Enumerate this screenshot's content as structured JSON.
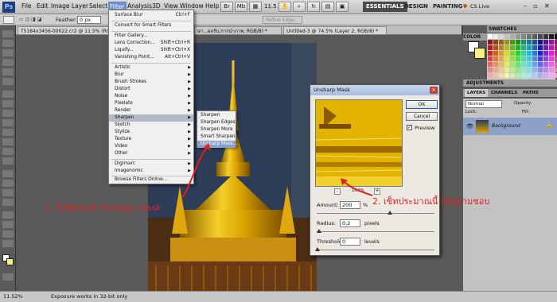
{
  "menubar": {
    "logo": "Ps",
    "items": [
      "File",
      "Edit",
      "Image",
      "Layer",
      "Select",
      "Filter",
      "Analysis",
      "3D",
      "View",
      "Window",
      "Help"
    ],
    "zoom": "11.5",
    "workspaces": [
      "ESSENTIALS",
      "DESIGN",
      "PAINTING"
    ],
    "cs_live": "CS Live"
  },
  "optionsbar": {
    "feather_label": "Feather:",
    "feather_value": "0 px",
    "refine_edge": "Refine Edge..."
  },
  "tabs": [
    "T5184x3456-00022.cr2 @ 11.5% (RGB/8",
    "ษา...ผลรับ,การนำภาพ, RGB/8) *",
    "Untitled-3 @ 74.5% (Layer 2, RGB/8) *"
  ],
  "filter_menu": {
    "top": [
      {
        "label": "Surface Blur",
        "shortcut": "Ctrl+F"
      },
      {
        "label": "Convert for Smart Filters",
        "shortcut": ""
      },
      {
        "label": "Filter Gallery...",
        "shortcut": ""
      },
      {
        "label": "Lens Correction...",
        "shortcut": "Shift+Ctrl+R"
      },
      {
        "label": "Liquify...",
        "shortcut": "Shift+Ctrl+X"
      },
      {
        "label": "Vanishing Point...",
        "shortcut": "Alt+Ctrl+V"
      }
    ],
    "groups": [
      "Artistic",
      "Blur",
      "Brush Strokes",
      "Distort",
      "Noise",
      "Pixelate",
      "Render",
      "Sharpen",
      "Sketch",
      "Stylize",
      "Texture",
      "Video",
      "Other"
    ],
    "plugins": [
      "Digimarc",
      "Imagenomic"
    ],
    "browse": "Browse Filters Online..."
  },
  "sharpen_submenu": [
    "Sharpen",
    "Sharpen Edges",
    "Sharpen More",
    "Smart Sharpen...",
    "Unsharp Mask..."
  ],
  "dialog": {
    "title": "Unsharp Mask",
    "ok": "OK",
    "cancel": "Cancel",
    "preview_label": "Preview",
    "zoom_out": "-",
    "zoom_pct": "100%",
    "zoom_in": "+",
    "amount_label": "Amount:",
    "amount_value": "200",
    "amount_unit": "%",
    "radius_label": "Radius:",
    "radius_value": "0.2",
    "radius_unit": "pixels",
    "threshold_label": "Threshold:",
    "threshold_value": "0",
    "threshold_unit": "levels"
  },
  "annotations": {
    "step1": "1. ใส่ฟิลเตอร์ Unsharp mask",
    "step2": "2. เซ็ทประมาณนี้ หรือตามชอบ"
  },
  "panels": {
    "color_tab": "COLOR",
    "swatches_tab": "SWATCHES",
    "adjustments": "ADJUSTMENTS",
    "tabs": [
      "LAYERS",
      "CHANNELS",
      "PATHS"
    ],
    "blend": "Normal",
    "opacity_label": "Opacity:",
    "lock_label": "Lock:",
    "fill_label": "Fill:",
    "layer_name": "Background"
  },
  "status": {
    "zoom": "11.52%",
    "message": "Exposure works in 32-bit only"
  },
  "colors": {
    "accent": "#6b8cc7",
    "annotation": "#e32020",
    "gold": "#e0b400"
  }
}
